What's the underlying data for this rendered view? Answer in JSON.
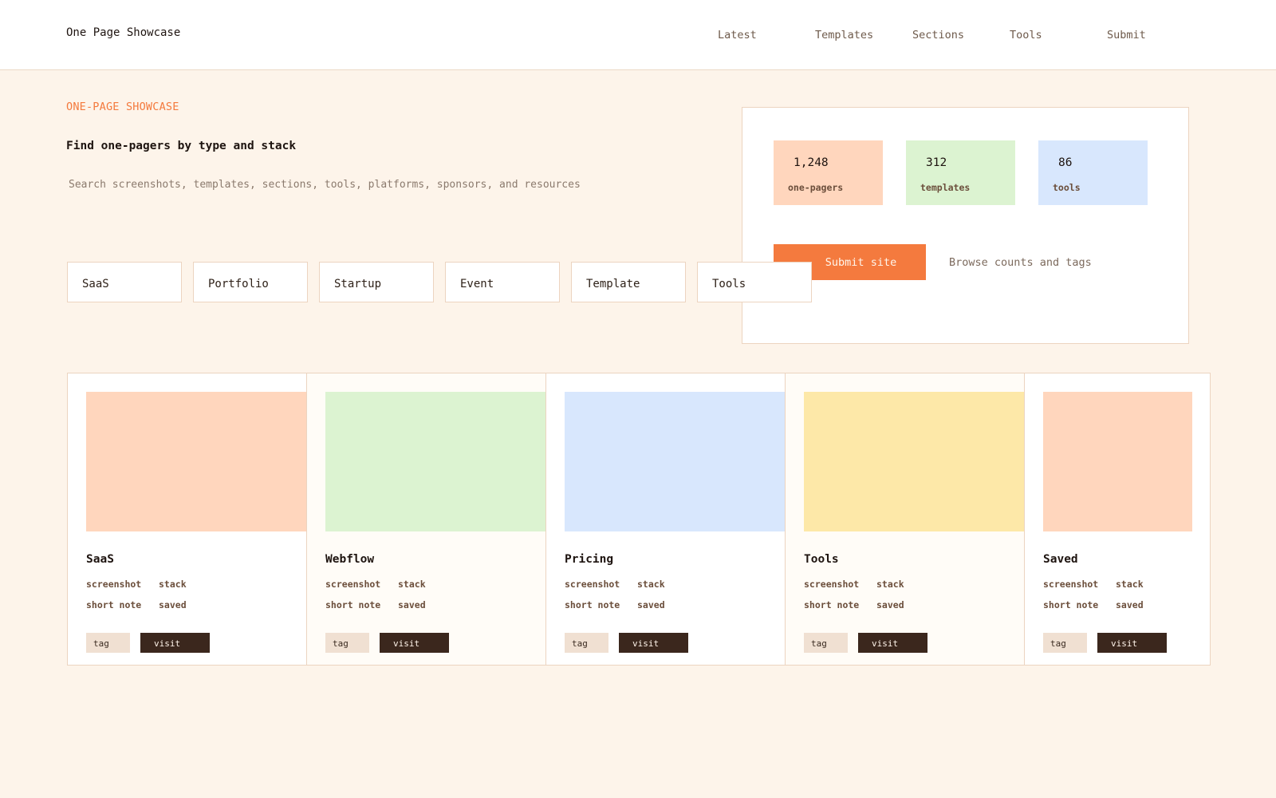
{
  "brand": "One Page Showcase",
  "nav": [
    "Latest",
    "Templates",
    "Sections",
    "Tools",
    "Submit"
  ],
  "hero": {
    "eyebrow": "ONE-PAGE SHOWCASE",
    "headline": "Find one-pagers by type and stack",
    "search_placeholder": "Search screenshots, templates, sections, tools, platforms, sponsors, and resources"
  },
  "chips": [
    "SaaS",
    "Portfolio",
    "Startup",
    "Event",
    "Template",
    "Tools"
  ],
  "stats": [
    {
      "value": "1,248",
      "label": "one-pagers",
      "color": "#ffd6bd"
    },
    {
      "value": "312",
      "label": "templates",
      "color": "#dcf3d1"
    },
    {
      "value": "86",
      "label": "tools",
      "color": "#d8e7fd"
    }
  ],
  "submit_label": "Submit site",
  "browse_label": "Browse counts and tags",
  "cards": [
    {
      "title": "SaaS",
      "color": "#ffd6bd",
      "meta": [
        "screenshot",
        "stack",
        "short note",
        "saved"
      ],
      "tag": "tag",
      "visit": "visit"
    },
    {
      "title": "Webflow",
      "color": "#dcf3d1",
      "meta": [
        "screenshot",
        "stack",
        "short note",
        "saved"
      ],
      "tag": "tag",
      "visit": "visit"
    },
    {
      "title": "Pricing",
      "color": "#d8e7fd",
      "meta": [
        "screenshot",
        "stack",
        "short note",
        "saved"
      ],
      "tag": "tag",
      "visit": "visit"
    },
    {
      "title": "Tools",
      "color": "#fde8a8",
      "meta": [
        "screenshot",
        "stack",
        "short note",
        "saved"
      ],
      "tag": "tag",
      "visit": "visit"
    },
    {
      "title": "Saved",
      "color": "#ffd6bd",
      "meta": [
        "screenshot",
        "stack",
        "short note",
        "saved"
      ],
      "tag": "tag",
      "visit": "visit"
    }
  ],
  "colors": {
    "accent": "#f47a3e",
    "dark": "#3b271d",
    "background": "#fdf4ea"
  }
}
